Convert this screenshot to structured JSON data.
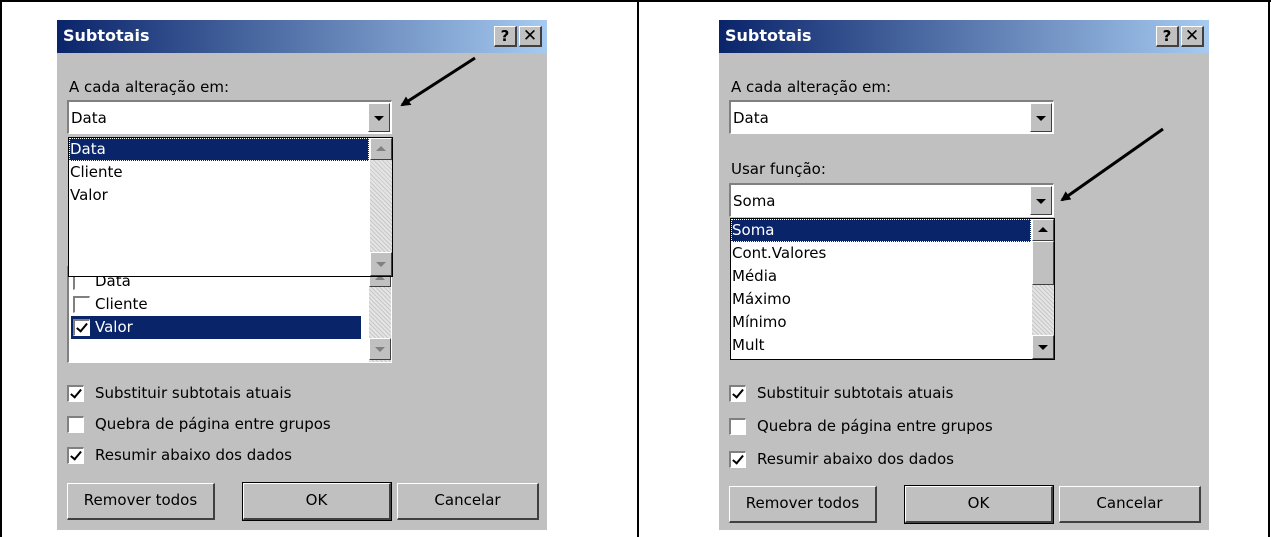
{
  "left_dialog": {
    "title": "Subtotais",
    "help_label": "?",
    "close_label": "✕",
    "group_by_label": "A cada alteração em:",
    "group_by_value": "Data",
    "group_by_options": [
      "Data",
      "Cliente",
      "Valor"
    ],
    "add_subtotal_items": [
      {
        "label": "Data",
        "checked": false
      },
      {
        "label": "Cliente",
        "checked": false
      },
      {
        "label": "Valor",
        "checked": true
      }
    ],
    "replace_label": "Substituir subtotais atuais",
    "replace_checked": true,
    "page_break_label": "Quebra de página entre grupos",
    "page_break_checked": false,
    "summary_label": "Resumir abaixo dos dados",
    "summary_checked": true,
    "remove_all_label": "Remover todos",
    "ok_label": "OK",
    "cancel_label": "Cancelar"
  },
  "right_dialog": {
    "title": "Subtotais",
    "help_label": "?",
    "close_label": "✕",
    "group_by_label": "A cada alteração em:",
    "group_by_value": "Data",
    "function_label": "Usar função:",
    "function_value": "Soma",
    "function_options": [
      "Soma",
      "Cont.Valores",
      "Média",
      "Máximo",
      "Mínimo",
      "Mult"
    ],
    "replace_label": "Substituir subtotais atuais",
    "replace_checked": true,
    "page_break_label": "Quebra de página entre grupos",
    "page_break_checked": false,
    "summary_label": "Resumir abaixo dos dados",
    "summary_checked": true,
    "remove_all_label": "Remover todos",
    "ok_label": "OK",
    "cancel_label": "Cancelar"
  },
  "colors": {
    "title_start": "#0a246a",
    "title_end": "#a6caf0",
    "face": "#c0c0c0",
    "selection": "#0a246a"
  }
}
